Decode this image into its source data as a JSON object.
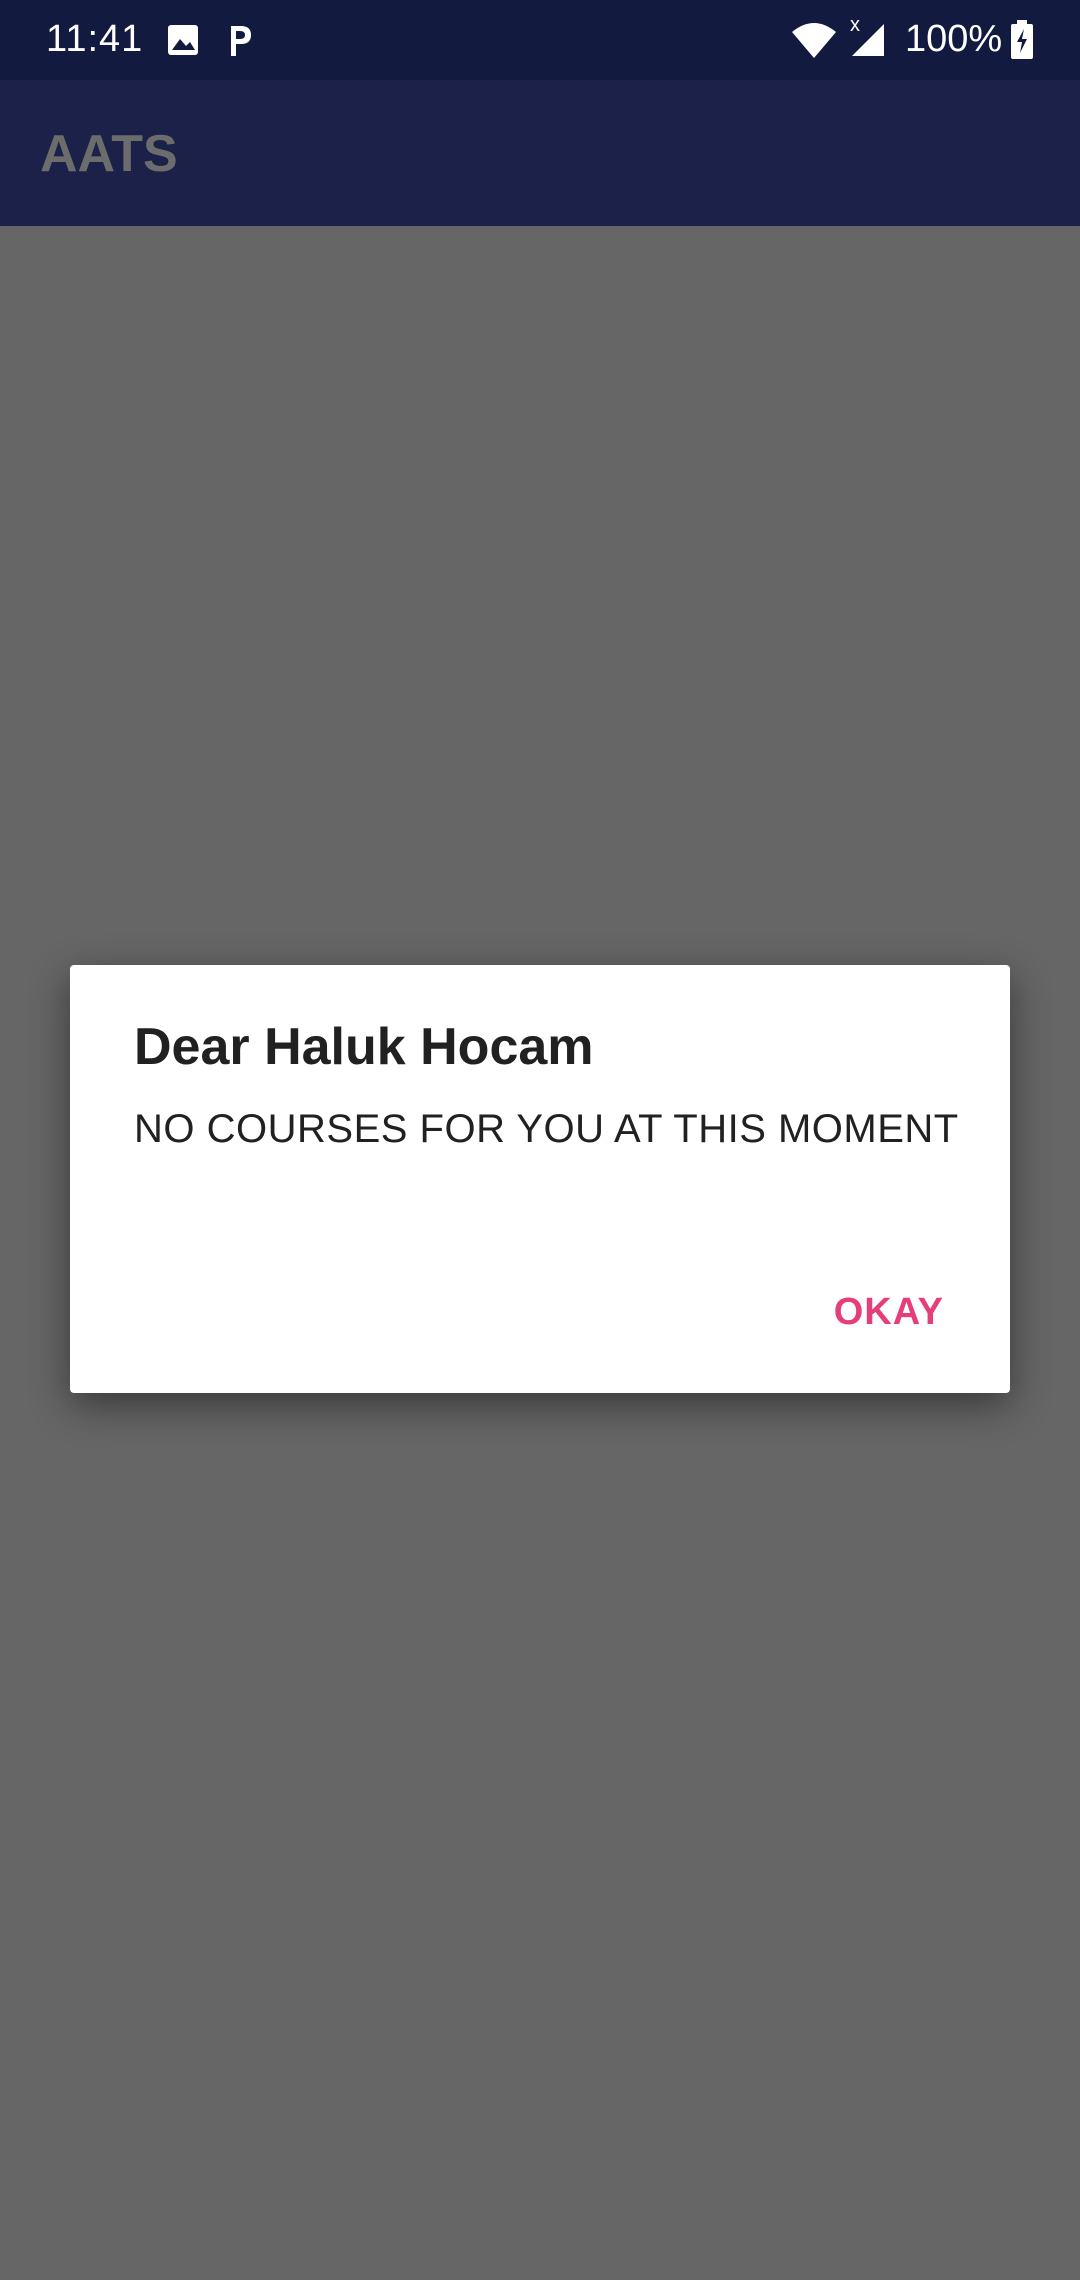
{
  "status_bar": {
    "time": "11:41",
    "battery": "100%",
    "icons": [
      "image-icon",
      "p-app-icon",
      "wifi-icon",
      "signal-icon",
      "battery-charging-icon"
    ]
  },
  "app_bar": {
    "title": "AATS"
  },
  "dialog": {
    "title": "Dear Haluk Hocam",
    "message": "NO COURSES FOR YOU AT THIS MOMENT",
    "ok_label": "OKAY"
  },
  "colors": {
    "status_bar_bg": "#121a3f",
    "app_bar_bg": "#1b2148",
    "scrim": "#666666",
    "accent": "#e63e7b"
  }
}
